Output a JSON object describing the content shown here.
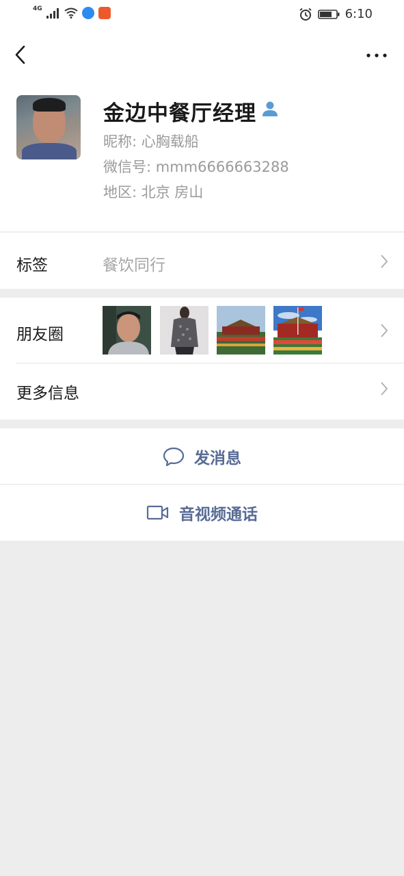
{
  "status_bar": {
    "network": "4G",
    "time": "6:10"
  },
  "profile": {
    "display_name": "金边中餐厅经理",
    "nickname": "昵称: 心胸载船",
    "wechat_id": "微信号: mmm6666663288",
    "region": "地区: 北京  房山"
  },
  "tags": {
    "label": "标签",
    "value": "餐饮同行"
  },
  "moments": {
    "label": "朋友圈"
  },
  "more_info": {
    "label": "更多信息"
  },
  "actions": {
    "send_message": "发消息",
    "av_call": "音视频通话"
  },
  "colors": {
    "link_blue": "#576b95",
    "page_bg": "#ededed",
    "secondary_text": "#9a9a9a"
  }
}
